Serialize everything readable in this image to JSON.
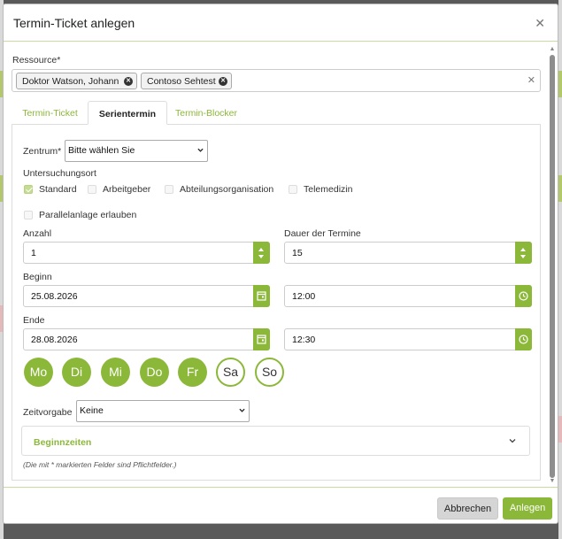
{
  "dialog": {
    "title": "Termin-Ticket anlegen"
  },
  "resource": {
    "label": "Ressource*",
    "chips": [
      "Doktor Watson, Johann",
      "Contoso Sehtest"
    ]
  },
  "tabs": [
    "Termin-Ticket",
    "Serientermin",
    "Termin-Blocker"
  ],
  "active_tab": "Serientermin",
  "zentrum": {
    "label": "Zentrum*",
    "value": "Bitte wählen Sie"
  },
  "untersuchungsort": {
    "label": "Untersuchungsort",
    "options": [
      {
        "label": "Standard",
        "checked": true
      },
      {
        "label": "Arbeitgeber",
        "checked": false
      },
      {
        "label": "Abteilungsorganisation",
        "checked": false
      },
      {
        "label": "Telemedizin",
        "checked": false
      }
    ]
  },
  "parallel": {
    "label": "Parallelanlage erlauben",
    "checked": false
  },
  "anzahl": {
    "label": "Anzahl",
    "value": "1"
  },
  "dauer": {
    "label": "Dauer der Termine",
    "value": "15"
  },
  "beginn": {
    "label": "Beginn",
    "date": "25.08.2026",
    "time": "12:00"
  },
  "ende": {
    "label": "Ende",
    "date": "28.08.2026",
    "time": "12:30"
  },
  "weekdays": [
    {
      "label": "Mo",
      "selected": true
    },
    {
      "label": "Di",
      "selected": true
    },
    {
      "label": "Mi",
      "selected": true
    },
    {
      "label": "Do",
      "selected": true
    },
    {
      "label": "Fr",
      "selected": true
    },
    {
      "label": "Sa",
      "selected": false
    },
    {
      "label": "So",
      "selected": false
    }
  ],
  "zeitvorgabe": {
    "label": "Zeitvorgabe",
    "value": "Keine"
  },
  "beginnzeiten": {
    "label": "Beginnzeiten"
  },
  "hint": "(Die mit * markierten Felder sind Pflichtfelder.)",
  "footer": {
    "cancel": "Abbrechen",
    "submit": "Anlegen"
  },
  "colors": {
    "accent": "#8cb83a"
  }
}
